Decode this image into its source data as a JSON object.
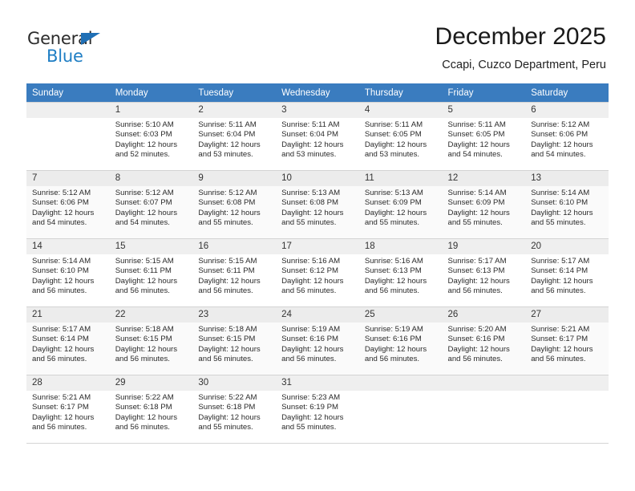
{
  "logo": {
    "text_primary": "General",
    "text_secondary": "Blue",
    "triangle_color": "#1f6fb5",
    "secondary_color": "#1f7ec4"
  },
  "header": {
    "title": "December 2025",
    "subtitle": "Ccapi, Cuzco Department, Peru"
  },
  "theme": {
    "header_row_bg": "#3a7cbf",
    "header_row_text": "#ffffff",
    "daynum_bg": "#efefef",
    "alt_row_bg": "#fafafa",
    "grid_line": "#d4d4d4"
  },
  "weekdays": [
    "Sunday",
    "Monday",
    "Tuesday",
    "Wednesday",
    "Thursday",
    "Friday",
    "Saturday"
  ],
  "labels": {
    "sunrise_prefix": "Sunrise: ",
    "sunset_prefix": "Sunset: ",
    "daylight_prefix": "Daylight: "
  },
  "weeks": [
    [
      {
        "day": "",
        "sunrise": "",
        "sunset": "",
        "daylight_line1": "",
        "daylight_line2": "",
        "empty": true
      },
      {
        "day": "1",
        "sunrise": "Sunrise: 5:10 AM",
        "sunset": "Sunset: 6:03 PM",
        "daylight_line1": "Daylight: 12 hours",
        "daylight_line2": "and 52 minutes."
      },
      {
        "day": "2",
        "sunrise": "Sunrise: 5:11 AM",
        "sunset": "Sunset: 6:04 PM",
        "daylight_line1": "Daylight: 12 hours",
        "daylight_line2": "and 53 minutes."
      },
      {
        "day": "3",
        "sunrise": "Sunrise: 5:11 AM",
        "sunset": "Sunset: 6:04 PM",
        "daylight_line1": "Daylight: 12 hours",
        "daylight_line2": "and 53 minutes."
      },
      {
        "day": "4",
        "sunrise": "Sunrise: 5:11 AM",
        "sunset": "Sunset: 6:05 PM",
        "daylight_line1": "Daylight: 12 hours",
        "daylight_line2": "and 53 minutes."
      },
      {
        "day": "5",
        "sunrise": "Sunrise: 5:11 AM",
        "sunset": "Sunset: 6:05 PM",
        "daylight_line1": "Daylight: 12 hours",
        "daylight_line2": "and 54 minutes."
      },
      {
        "day": "6",
        "sunrise": "Sunrise: 5:12 AM",
        "sunset": "Sunset: 6:06 PM",
        "daylight_line1": "Daylight: 12 hours",
        "daylight_line2": "and 54 minutes."
      }
    ],
    [
      {
        "day": "7",
        "sunrise": "Sunrise: 5:12 AM",
        "sunset": "Sunset: 6:06 PM",
        "daylight_line1": "Daylight: 12 hours",
        "daylight_line2": "and 54 minutes."
      },
      {
        "day": "8",
        "sunrise": "Sunrise: 5:12 AM",
        "sunset": "Sunset: 6:07 PM",
        "daylight_line1": "Daylight: 12 hours",
        "daylight_line2": "and 54 minutes."
      },
      {
        "day": "9",
        "sunrise": "Sunrise: 5:12 AM",
        "sunset": "Sunset: 6:08 PM",
        "daylight_line1": "Daylight: 12 hours",
        "daylight_line2": "and 55 minutes."
      },
      {
        "day": "10",
        "sunrise": "Sunrise: 5:13 AM",
        "sunset": "Sunset: 6:08 PM",
        "daylight_line1": "Daylight: 12 hours",
        "daylight_line2": "and 55 minutes."
      },
      {
        "day": "11",
        "sunrise": "Sunrise: 5:13 AM",
        "sunset": "Sunset: 6:09 PM",
        "daylight_line1": "Daylight: 12 hours",
        "daylight_line2": "and 55 minutes."
      },
      {
        "day": "12",
        "sunrise": "Sunrise: 5:14 AM",
        "sunset": "Sunset: 6:09 PM",
        "daylight_line1": "Daylight: 12 hours",
        "daylight_line2": "and 55 minutes."
      },
      {
        "day": "13",
        "sunrise": "Sunrise: 5:14 AM",
        "sunset": "Sunset: 6:10 PM",
        "daylight_line1": "Daylight: 12 hours",
        "daylight_line2": "and 55 minutes."
      }
    ],
    [
      {
        "day": "14",
        "sunrise": "Sunrise: 5:14 AM",
        "sunset": "Sunset: 6:10 PM",
        "daylight_line1": "Daylight: 12 hours",
        "daylight_line2": "and 56 minutes."
      },
      {
        "day": "15",
        "sunrise": "Sunrise: 5:15 AM",
        "sunset": "Sunset: 6:11 PM",
        "daylight_line1": "Daylight: 12 hours",
        "daylight_line2": "and 56 minutes."
      },
      {
        "day": "16",
        "sunrise": "Sunrise: 5:15 AM",
        "sunset": "Sunset: 6:11 PM",
        "daylight_line1": "Daylight: 12 hours",
        "daylight_line2": "and 56 minutes."
      },
      {
        "day": "17",
        "sunrise": "Sunrise: 5:16 AM",
        "sunset": "Sunset: 6:12 PM",
        "daylight_line1": "Daylight: 12 hours",
        "daylight_line2": "and 56 minutes."
      },
      {
        "day": "18",
        "sunrise": "Sunrise: 5:16 AM",
        "sunset": "Sunset: 6:13 PM",
        "daylight_line1": "Daylight: 12 hours",
        "daylight_line2": "and 56 minutes."
      },
      {
        "day": "19",
        "sunrise": "Sunrise: 5:17 AM",
        "sunset": "Sunset: 6:13 PM",
        "daylight_line1": "Daylight: 12 hours",
        "daylight_line2": "and 56 minutes."
      },
      {
        "day": "20",
        "sunrise": "Sunrise: 5:17 AM",
        "sunset": "Sunset: 6:14 PM",
        "daylight_line1": "Daylight: 12 hours",
        "daylight_line2": "and 56 minutes."
      }
    ],
    [
      {
        "day": "21",
        "sunrise": "Sunrise: 5:17 AM",
        "sunset": "Sunset: 6:14 PM",
        "daylight_line1": "Daylight: 12 hours",
        "daylight_line2": "and 56 minutes."
      },
      {
        "day": "22",
        "sunrise": "Sunrise: 5:18 AM",
        "sunset": "Sunset: 6:15 PM",
        "daylight_line1": "Daylight: 12 hours",
        "daylight_line2": "and 56 minutes."
      },
      {
        "day": "23",
        "sunrise": "Sunrise: 5:18 AM",
        "sunset": "Sunset: 6:15 PM",
        "daylight_line1": "Daylight: 12 hours",
        "daylight_line2": "and 56 minutes."
      },
      {
        "day": "24",
        "sunrise": "Sunrise: 5:19 AM",
        "sunset": "Sunset: 6:16 PM",
        "daylight_line1": "Daylight: 12 hours",
        "daylight_line2": "and 56 minutes."
      },
      {
        "day": "25",
        "sunrise": "Sunrise: 5:19 AM",
        "sunset": "Sunset: 6:16 PM",
        "daylight_line1": "Daylight: 12 hours",
        "daylight_line2": "and 56 minutes."
      },
      {
        "day": "26",
        "sunrise": "Sunrise: 5:20 AM",
        "sunset": "Sunset: 6:16 PM",
        "daylight_line1": "Daylight: 12 hours",
        "daylight_line2": "and 56 minutes."
      },
      {
        "day": "27",
        "sunrise": "Sunrise: 5:21 AM",
        "sunset": "Sunset: 6:17 PM",
        "daylight_line1": "Daylight: 12 hours",
        "daylight_line2": "and 56 minutes."
      }
    ],
    [
      {
        "day": "28",
        "sunrise": "Sunrise: 5:21 AM",
        "sunset": "Sunset: 6:17 PM",
        "daylight_line1": "Daylight: 12 hours",
        "daylight_line2": "and 56 minutes."
      },
      {
        "day": "29",
        "sunrise": "Sunrise: 5:22 AM",
        "sunset": "Sunset: 6:18 PM",
        "daylight_line1": "Daylight: 12 hours",
        "daylight_line2": "and 56 minutes."
      },
      {
        "day": "30",
        "sunrise": "Sunrise: 5:22 AM",
        "sunset": "Sunset: 6:18 PM",
        "daylight_line1": "Daylight: 12 hours",
        "daylight_line2": "and 55 minutes."
      },
      {
        "day": "31",
        "sunrise": "Sunrise: 5:23 AM",
        "sunset": "Sunset: 6:19 PM",
        "daylight_line1": "Daylight: 12 hours",
        "daylight_line2": "and 55 minutes."
      },
      {
        "day": "",
        "sunrise": "",
        "sunset": "",
        "daylight_line1": "",
        "daylight_line2": "",
        "empty": true
      },
      {
        "day": "",
        "sunrise": "",
        "sunset": "",
        "daylight_line1": "",
        "daylight_line2": "",
        "empty": true
      },
      {
        "day": "",
        "sunrise": "",
        "sunset": "",
        "daylight_line1": "",
        "daylight_line2": "",
        "empty": true
      }
    ]
  ]
}
